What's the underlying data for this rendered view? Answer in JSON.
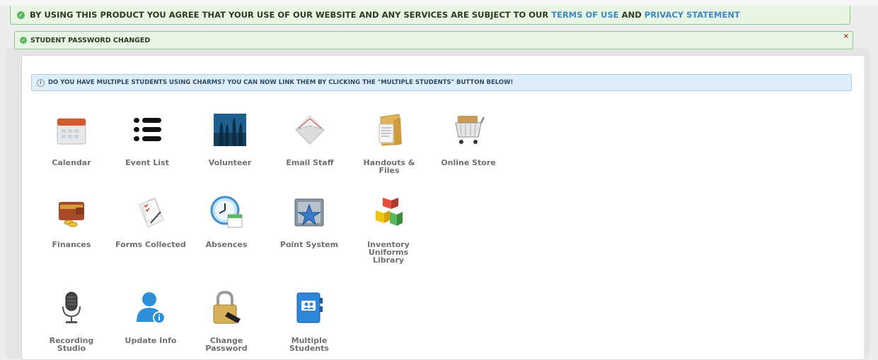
{
  "agreement": {
    "prefix": "BY USING THIS PRODUCT YOU AGREE THAT YOUR USE OF OUR WEBSITE AND ANY SERVICES ARE SUBJECT TO OUR",
    "terms_link": "TERMS OF USE",
    "conjunction": "AND",
    "privacy_link": "PRIVACY STATEMENT"
  },
  "flash_message": {
    "text": "STUDENT PASSWORD CHANGED",
    "close": "×"
  },
  "info_notice": {
    "icon": "i",
    "text": "DO YOU HAVE MULTIPLE STUDENTS USING CHARMS? YOU CAN NOW LINK THEM BY CLICKING THE \"MULTIPLE STUDENTS\" BUTTON BELOW!"
  },
  "check_glyph": "✓",
  "tiles": [
    {
      "label": "Calendar",
      "icon": "calendar-icon"
    },
    {
      "label": "Event List",
      "icon": "list-icon"
    },
    {
      "label": "Volunteer",
      "icon": "volunteer-hands-icon"
    },
    {
      "label": "Email Staff",
      "icon": "envelope-icon"
    },
    {
      "label": "Handouts & Files",
      "icon": "folder-icon"
    },
    {
      "label": "Online Store",
      "icon": "shopping-cart-icon"
    },
    {
      "label": "Finances",
      "icon": "wallet-icon"
    },
    {
      "label": "Forms Collected",
      "icon": "forms-icon"
    },
    {
      "label": "Absences",
      "icon": "clock-icon"
    },
    {
      "label": "Point System",
      "icon": "star-folder-icon"
    },
    {
      "label": "Inventory\nUniforms\nLibrary",
      "icon": "blocks-icon"
    },
    {
      "label": "Recording\nStudio",
      "icon": "microphone-icon"
    },
    {
      "label": "Update Info",
      "icon": "user-info-icon"
    },
    {
      "label": "Change\nPassword",
      "icon": "padlock-icon"
    },
    {
      "label": "Multiple\nStudents",
      "icon": "contacts-book-icon"
    }
  ]
}
